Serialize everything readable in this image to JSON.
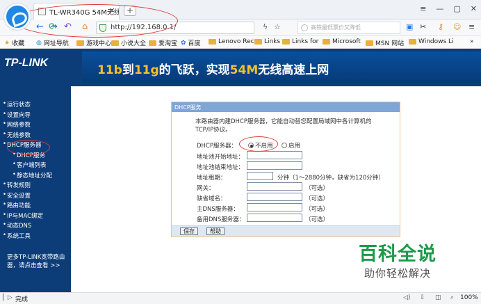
{
  "browser": {
    "tab_title": "TL-WR340G 54M无线宽",
    "tab_close": "×",
    "new_tab": "+",
    "window_controls": [
      "≡",
      "—",
      "▢",
      "✕"
    ],
    "url": "http://192.168.0.1/",
    "search_placeholder": "高铁最低票价又降低",
    "icons": [
      "back-icon",
      "forward-icon",
      "refresh-icon",
      "undo-icon",
      "home-icon",
      "shield-icon",
      "lightning-icon",
      "star-icon",
      "search-icon",
      "extensions-icon",
      "scissors-icon",
      "key-icon",
      "smiley-icon",
      "menu-icon"
    ]
  },
  "bookmarks": {
    "items": [
      "收藏",
      "网址导航",
      "游戏中心",
      "小说大全",
      "爱淘宝",
      "百度",
      "Lenovo Rec",
      "Links",
      "Links for",
      "Microsoft",
      "MSN 网站",
      "Windows Li",
      "»"
    ]
  },
  "banner": {
    "brand": "TP-LINK",
    "slogan_a": "11b",
    "slogan_b": "到",
    "slogan_c": "11g",
    "slogan_d": "的飞跃，实现",
    "slogan_e": "54M",
    "slogan_f": "无线高速上网"
  },
  "sidebar": {
    "items": [
      {
        "label": "运行状态",
        "level": 0
      },
      {
        "label": "设置向导",
        "level": 0
      },
      {
        "label": "网络参数",
        "level": 0
      },
      {
        "label": "无线参数",
        "level": 0
      },
      {
        "label": "DHCP服务器",
        "level": 0
      },
      {
        "label": "DHCP服务",
        "level": 1
      },
      {
        "label": "客户端列表",
        "level": 1
      },
      {
        "label": "静态地址分配",
        "level": 1
      },
      {
        "label": "转发规则",
        "level": 0
      },
      {
        "label": "安全设置",
        "level": 0
      },
      {
        "label": "路由功能",
        "level": 0
      },
      {
        "label": "IP与MAC绑定",
        "level": 0
      },
      {
        "label": "动态DNS",
        "level": 0
      },
      {
        "label": "系统工具",
        "level": 0
      }
    ],
    "note": "更多TP-LINK宽带路由器，请点击查看 >>"
  },
  "panel": {
    "title": "DHCP服务",
    "description": "本路由器内建DHCP服务器，它能自动替您配置局域网中各计算机的TCP/IP协议。",
    "dhcp_label": "DHCP服务器：",
    "disable": "不启用",
    "enable": "启用",
    "start_label": "地址池开始地址：",
    "end_label": "地址池结束地址：",
    "lease_label": "地址租期：",
    "lease_hint": "分钟（1～2880分钟，缺省为120分钟）",
    "gateway_label": "网关：",
    "gateway_hint": "（可选）",
    "domain_label": "缺省域名：",
    "domain_hint": "（可选）",
    "dns1_label": "主DNS服务器：",
    "dns1_hint": "（可选）",
    "dns2_label": "备用DNS服务器：",
    "dns2_hint": "（可选）",
    "save": "保存",
    "help": "帮助"
  },
  "watermark": {
    "line1": "百科全说",
    "line2": "助你轻松解决"
  },
  "status": {
    "text": "完成",
    "zoom": "100%"
  }
}
